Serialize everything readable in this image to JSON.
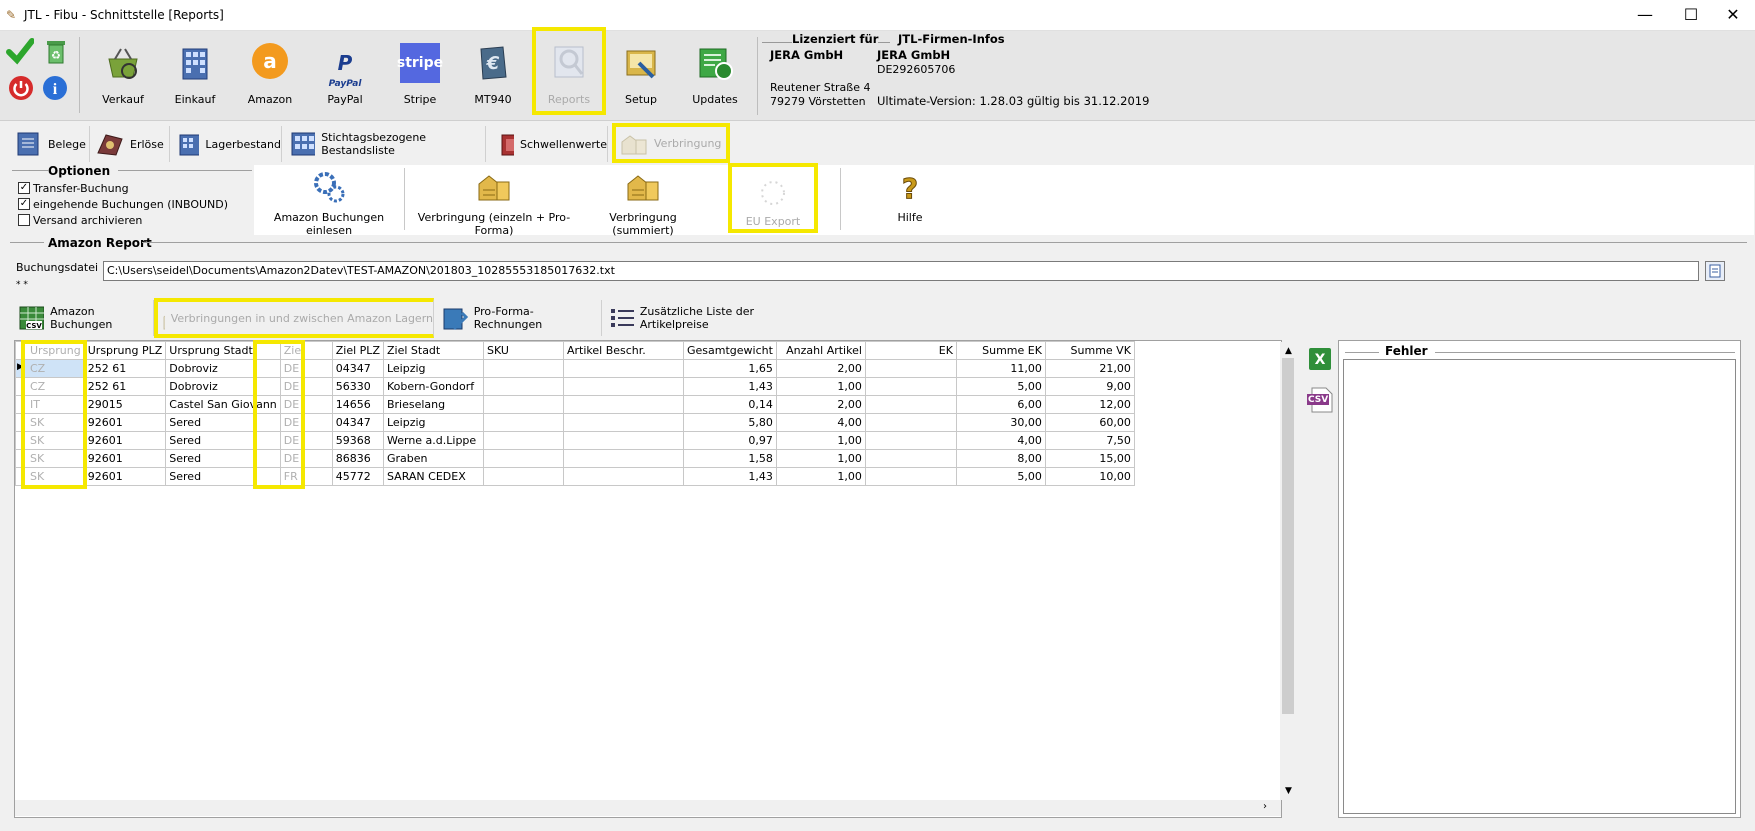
{
  "window": {
    "title": "JTL - Fibu - Schnittstelle [Reports]",
    "minimize": "—",
    "maximize": "☐",
    "close": "✕"
  },
  "toolbar": {
    "buttons": [
      {
        "label": "Verkauf"
      },
      {
        "label": "Einkauf"
      },
      {
        "label": "Amazon"
      },
      {
        "label": "PayPal"
      },
      {
        "label": "Stripe"
      },
      {
        "label": "MT940"
      },
      {
        "label": "Reports"
      },
      {
        "label": "Setup"
      },
      {
        "label": "Updates"
      }
    ],
    "stripe_logo": "stripe",
    "paypal_logo": "PayPal",
    "amazon_logo": "a"
  },
  "license": {
    "licensed_for_label": "Lizenziert für",
    "company_infos_label": "JTL-Firmen-Infos",
    "company": "JERA GmbH",
    "street": "Reutener Straße 4",
    "city": "79279 Vörstetten",
    "company2": "JERA GmbH",
    "vat": "DE292605706",
    "version": "Ultimate-Version: 1.28.03 gültig bis 31.12.2019"
  },
  "tabs": [
    {
      "label": "Belege"
    },
    {
      "label": "Erlöse"
    },
    {
      "label": "Lagerbestand"
    },
    {
      "label": "Stichtagsbezogene Bestandsliste"
    },
    {
      "label": "Schwellenwerte"
    },
    {
      "label": "Verbringung"
    }
  ],
  "options": {
    "title": "Optionen",
    "items": [
      {
        "label": "Transfer-Buchung",
        "checked": "✓"
      },
      {
        "label": "eingehende Buchungen (INBOUND)",
        "checked": "✓"
      },
      {
        "label": "Versand archivieren",
        "checked": ""
      }
    ]
  },
  "actions": [
    {
      "label": "Amazon Buchungen einlesen"
    },
    {
      "label": "Verbringung (einzeln + Pro-Forma)"
    },
    {
      "label": "Verbringung (summiert)"
    },
    {
      "label": "EU Export"
    },
    {
      "label": "Hilfe"
    }
  ],
  "report": {
    "title": "Amazon Report",
    "file_label": "Buchungsdatei",
    "file_path": "C:\\Users\\seidel\\Documents\\Amazon2Datev\\TEST-AMAZON\\201803_10285553185017632.txt",
    "dots": "* *"
  },
  "subtabs": [
    {
      "label": "Amazon Buchungen"
    },
    {
      "label": "Verbringungen in und zwischen Amazon Lagern"
    },
    {
      "label": "Pro-Forma-Rechnungen"
    },
    {
      "label": "Zusätzliche Liste der Artikelpreise"
    }
  ],
  "grid": {
    "columns": [
      "Ursprung",
      "Ursprung PLZ",
      "Ursprung Stadt",
      "Ziel",
      "Ziel PLZ",
      "Ziel Stadt",
      "SKU",
      "Artikel Beschr.",
      "Gesamtgewicht",
      "Anzahl Artikel",
      "EK",
      "Summe EK",
      "Summe VK"
    ],
    "rows": [
      [
        "CZ",
        "252 61",
        "Dobroviz",
        "DE",
        "04347",
        "Leipzig",
        "",
        "",
        "1,65",
        "2,00",
        "",
        "11,00",
        "21,00"
      ],
      [
        "CZ",
        "252 61",
        "Dobroviz",
        "DE",
        "56330",
        "Kobern-Gondorf",
        "",
        "",
        "1,43",
        "1,00",
        "",
        "5,00",
        "9,00"
      ],
      [
        "IT",
        "29015",
        "Castel San Giovann",
        "DE",
        "14656",
        "Brieselang",
        "",
        "",
        "0,14",
        "2,00",
        "",
        "6,00",
        "12,00"
      ],
      [
        "SK",
        "92601",
        "Sered",
        "DE",
        "04347",
        "Leipzig",
        "",
        "",
        "5,80",
        "4,00",
        "",
        "30,00",
        "60,00"
      ],
      [
        "SK",
        "92601",
        "Sered",
        "DE",
        "59368",
        "Werne a.d.Lippe",
        "",
        "",
        "0,97",
        "1,00",
        "",
        "4,00",
        "7,50"
      ],
      [
        "SK",
        "92601",
        "Sered",
        "DE",
        "86836",
        "Graben",
        "",
        "",
        "1,58",
        "1,00",
        "",
        "8,00",
        "15,00"
      ],
      [
        "SK",
        "92601",
        "Sered",
        "FR",
        "45772",
        "SARAN CEDEX",
        "",
        "",
        "1,43",
        "1,00",
        "",
        "5,00",
        "10,00"
      ]
    ]
  },
  "side_buttons": {
    "csv": "CSV"
  },
  "errors": {
    "title": "Fehler"
  }
}
